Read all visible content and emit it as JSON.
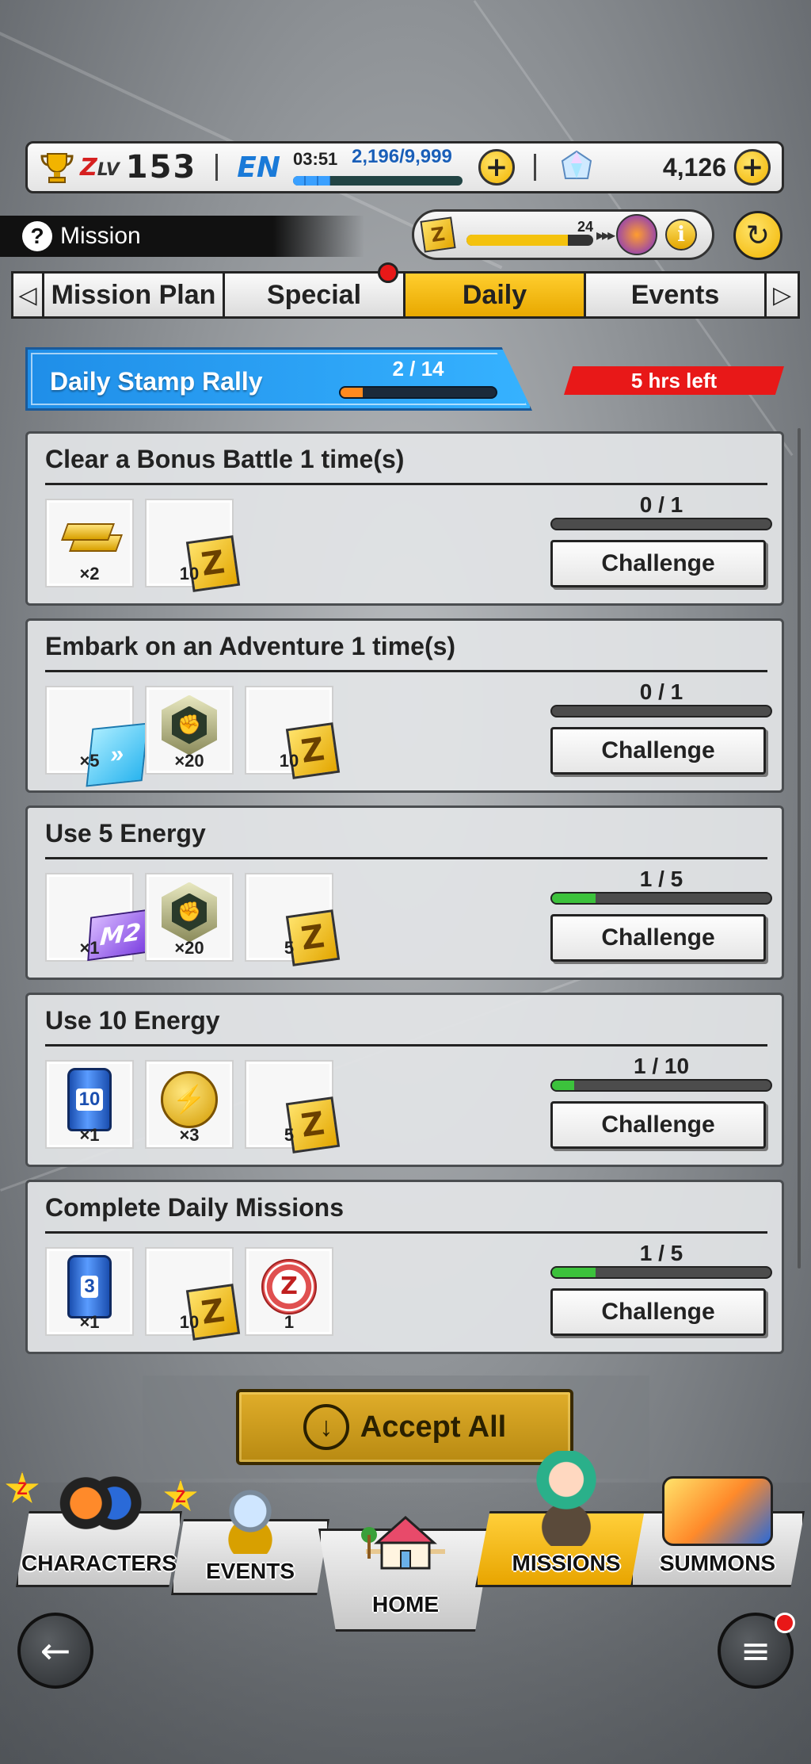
{
  "status_bar": {
    "zlv_label": "Z",
    "zlv_suffix": "LV",
    "level": "153",
    "en_label": "EN",
    "energy_timer": "03:51",
    "energy_value": "2,196/9,999",
    "energy_fraction": 0.22,
    "chrono_crystals": "4,126",
    "plus_symbol": "+"
  },
  "header": {
    "title": "Mission",
    "help_symbol": "?",
    "pass_points": "24",
    "pass_progress_fraction": 0.8,
    "info_symbol": "i",
    "refresh_symbol": "↻"
  },
  "tabs": {
    "left_arrow": "◁",
    "right_arrow": "▷",
    "items": [
      {
        "label": "Mission Plan",
        "active": false
      },
      {
        "label": "Special",
        "active": false,
        "has_notification": true
      },
      {
        "label": "Daily",
        "active": true
      },
      {
        "label": "Events",
        "active": false
      }
    ]
  },
  "stamp_rally": {
    "title": "Daily Stamp Rally",
    "progress_text": "2 / 14",
    "progress_fraction": 0.143,
    "time_left": "5 hrs left"
  },
  "missions": [
    {
      "title": "Clear a Bonus Battle 1 time(s)",
      "rewards": [
        {
          "icon": "gold-bars-icon",
          "qty": "×2"
        },
        {
          "icon": "z-power-ticket-icon",
          "glyph": "Z",
          "qty": "10"
        }
      ],
      "progress_text": "0 / 1",
      "progress_fraction": 0,
      "button_label": "Challenge"
    },
    {
      "title": "Embark on an Adventure 1 time(s)",
      "rewards": [
        {
          "icon": "blue-ticket-icon",
          "qty": "×5"
        },
        {
          "icon": "training-medal-icon",
          "qty": "×20"
        },
        {
          "icon": "z-power-ticket-icon",
          "glyph": "Z",
          "qty": "10"
        }
      ],
      "progress_text": "0 / 1",
      "progress_fraction": 0,
      "button_label": "Challenge"
    },
    {
      "title": "Use 5 Energy",
      "rewards": [
        {
          "icon": "m2-ticket-icon",
          "glyph": "M2",
          "qty": "×1"
        },
        {
          "icon": "training-medal-icon",
          "qty": "×20"
        },
        {
          "icon": "z-power-ticket-icon",
          "glyph": "Z",
          "qty": "5"
        }
      ],
      "progress_text": "1 / 5",
      "progress_fraction": 0.2,
      "button_label": "Challenge"
    },
    {
      "title": "Use 10 Energy",
      "rewards": [
        {
          "icon": "energy-can-icon",
          "glyph": "10",
          "qty": "×1"
        },
        {
          "icon": "gold-coin-icon",
          "qty": "×3"
        },
        {
          "icon": "z-power-ticket-icon",
          "glyph": "Z",
          "qty": "5"
        }
      ],
      "progress_text": "1 / 10",
      "progress_fraction": 0.1,
      "button_label": "Challenge"
    },
    {
      "title": "Complete Daily Missions",
      "rewards": [
        {
          "icon": "energy-can-icon",
          "glyph": "3",
          "qty": "×1"
        },
        {
          "icon": "z-power-ticket-icon",
          "glyph": "Z",
          "qty": "10"
        },
        {
          "icon": "red-z-token-icon",
          "glyph": "Z",
          "qty": "1"
        }
      ],
      "progress_text": "1 / 5",
      "progress_fraction": 0.2,
      "button_label": "Challenge"
    }
  ],
  "accept_all": {
    "label": "Accept All",
    "icon": "download-arrow-icon"
  },
  "bottom_nav": {
    "items": [
      {
        "label": "CHARACTERS",
        "active": false,
        "badge": true
      },
      {
        "label": "EVENTS",
        "active": false,
        "badge": true
      },
      {
        "label": "HOME",
        "active": false,
        "badge": false
      },
      {
        "label": "MISSIONS",
        "active": true,
        "badge": false
      },
      {
        "label": "SUMMONS",
        "active": false,
        "badge": false
      }
    ],
    "badge_glyph": "Z"
  },
  "back_button": {
    "symbol": "←"
  },
  "menu_button": {
    "symbol": "≡"
  },
  "colors": {
    "accent_yellow": "#f2b400",
    "progress_green": "#3cc23c",
    "rally_blue": "#1f8ee8",
    "alert_red": "#e81818"
  }
}
